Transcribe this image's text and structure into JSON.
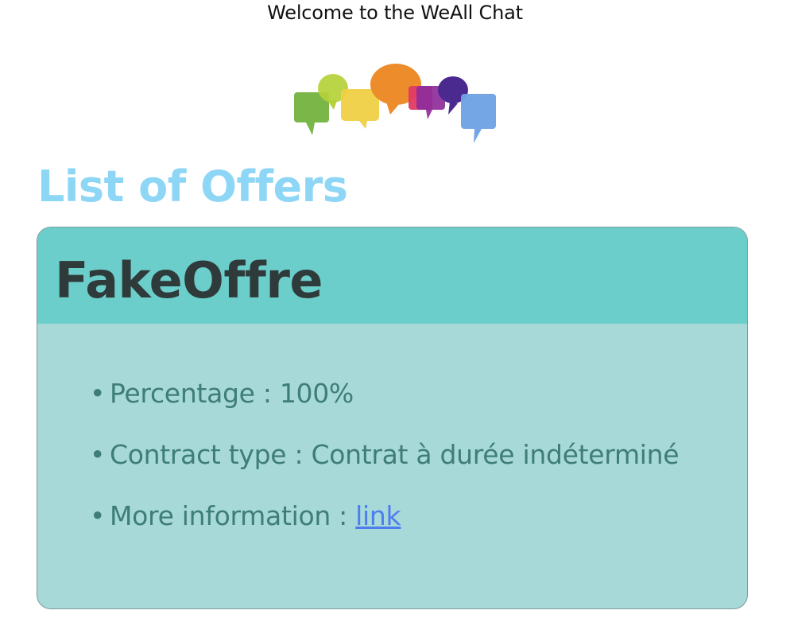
{
  "header": {
    "welcome_text": "Welcome to the WeAll Chat"
  },
  "logo": {
    "icon": "speech-bubbles-logo",
    "colors": [
      "#7ab648",
      "#b5d139",
      "#efd045",
      "#ec8c2b",
      "#e13a63",
      "#8e2c9a",
      "#4b2a8f",
      "#6ea1e4"
    ]
  },
  "main": {
    "title": "List of Offers",
    "offers": [
      {
        "name": "FakeOffre",
        "percentage_label": "Percentage : ",
        "percentage_value": "100%",
        "contract_label": "Contract type : ",
        "contract_value": "Contrat à durée indéterminé",
        "info_label": "More information : ",
        "info_link_text": "link"
      }
    ]
  },
  "theme": {
    "title_color": "#8dd6f5",
    "card_header_color": "#6bceca",
    "card_body_color": "#a7d9d8",
    "text_color": "#3e7d79",
    "link_color": "#4f7df0"
  }
}
